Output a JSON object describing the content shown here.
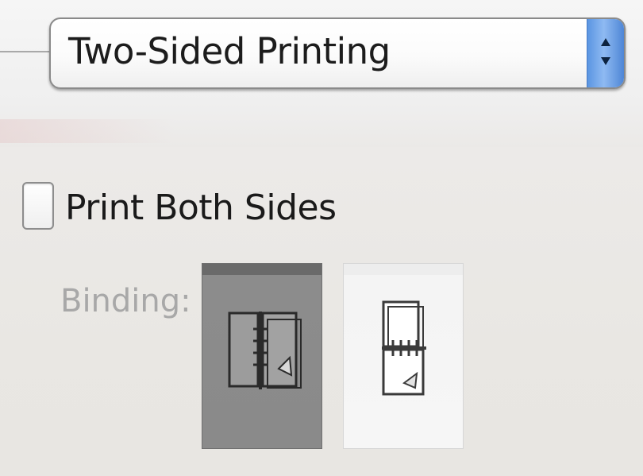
{
  "dialog": {
    "section_popup": {
      "selected_label": "Two-Sided Printing"
    },
    "two_sided": {
      "checkbox_label": "Print Both Sides",
      "checked": false
    },
    "binding": {
      "label": "Binding:",
      "options": [
        {
          "id": "long-edge",
          "icon": "long-edge-binding-icon",
          "selected": true
        },
        {
          "id": "short-edge",
          "icon": "short-edge-binding-icon",
          "selected": false
        }
      ]
    },
    "colors": {
      "stepper_blue": "#6ea1e8",
      "selected_bg": "#8a8a8a",
      "disabled_text": "#a8a8a8"
    }
  }
}
